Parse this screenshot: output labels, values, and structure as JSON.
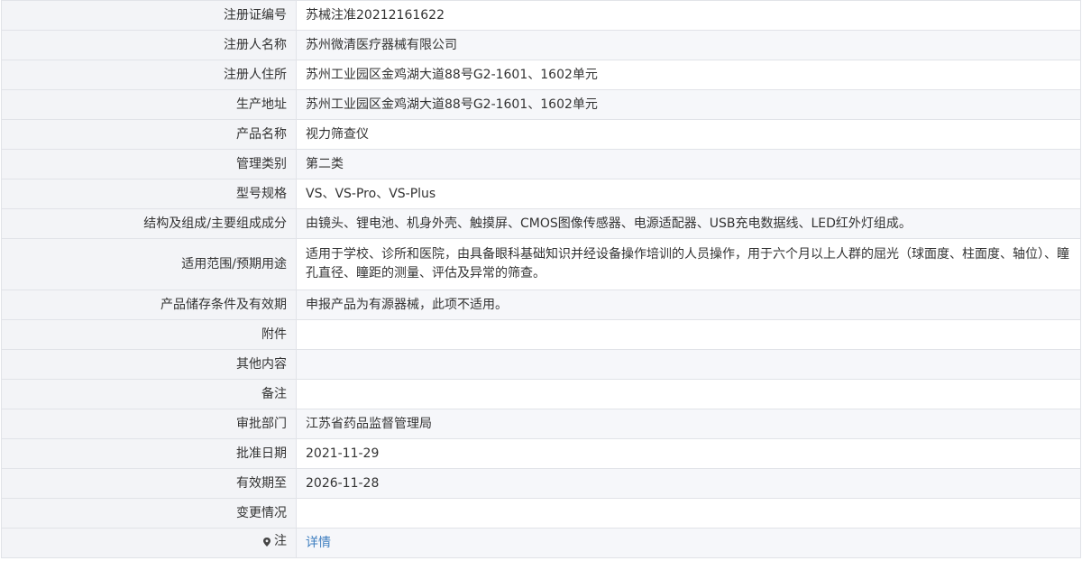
{
  "rows": [
    {
      "label": "注册证编号",
      "value": "苏械注准20212161622"
    },
    {
      "label": "注册人名称",
      "value": "苏州微清医疗器械有限公司"
    },
    {
      "label": "注册人住所",
      "value": "苏州工业园区金鸡湖大道88号G2-1601、1602单元"
    },
    {
      "label": "生产地址",
      "value": "苏州工业园区金鸡湖大道88号G2-1601、1602单元"
    },
    {
      "label": "产品名称",
      "value": "视力筛查仪"
    },
    {
      "label": "管理类别",
      "value": "第二类"
    },
    {
      "label": "型号规格",
      "value": "VS、VS-Pro、VS-Plus"
    },
    {
      "label": "结构及组成/主要组成成分",
      "value": "由镜头、锂电池、机身外壳、触摸屏、CMOS图像传感器、电源适配器、USB充电数据线、LED红外灯组成。"
    },
    {
      "label": "适用范围/预期用途",
      "value": "适用于学校、诊所和医院，由具备眼科基础知识并经设备操作培训的人员操作，用于六个月以上人群的屈光（球面度、柱面度、轴位）、瞳孔直径、瞳距的测量、评估及异常的筛查。"
    },
    {
      "label": "产品储存条件及有效期",
      "value": "申报产品为有源器械，此项不适用。"
    },
    {
      "label": "附件",
      "value": ""
    },
    {
      "label": "其他内容",
      "value": ""
    },
    {
      "label": "备注",
      "value": ""
    },
    {
      "label": "审批部门",
      "value": "江苏省药品监督管理局"
    },
    {
      "label": "批准日期",
      "value": "2021-11-29"
    },
    {
      "label": "有效期至",
      "value": "2026-11-28"
    },
    {
      "label": "变更情况",
      "value": ""
    }
  ],
  "note_row": {
    "icon": "pin-icon",
    "label": "注",
    "link_text": "详情"
  },
  "colors": {
    "border": "#e1e3e8",
    "label_bg": "#f3f4f7",
    "shaded_bg": "#f6f7fa",
    "link": "#3f7fc0",
    "text": "#333333"
  }
}
